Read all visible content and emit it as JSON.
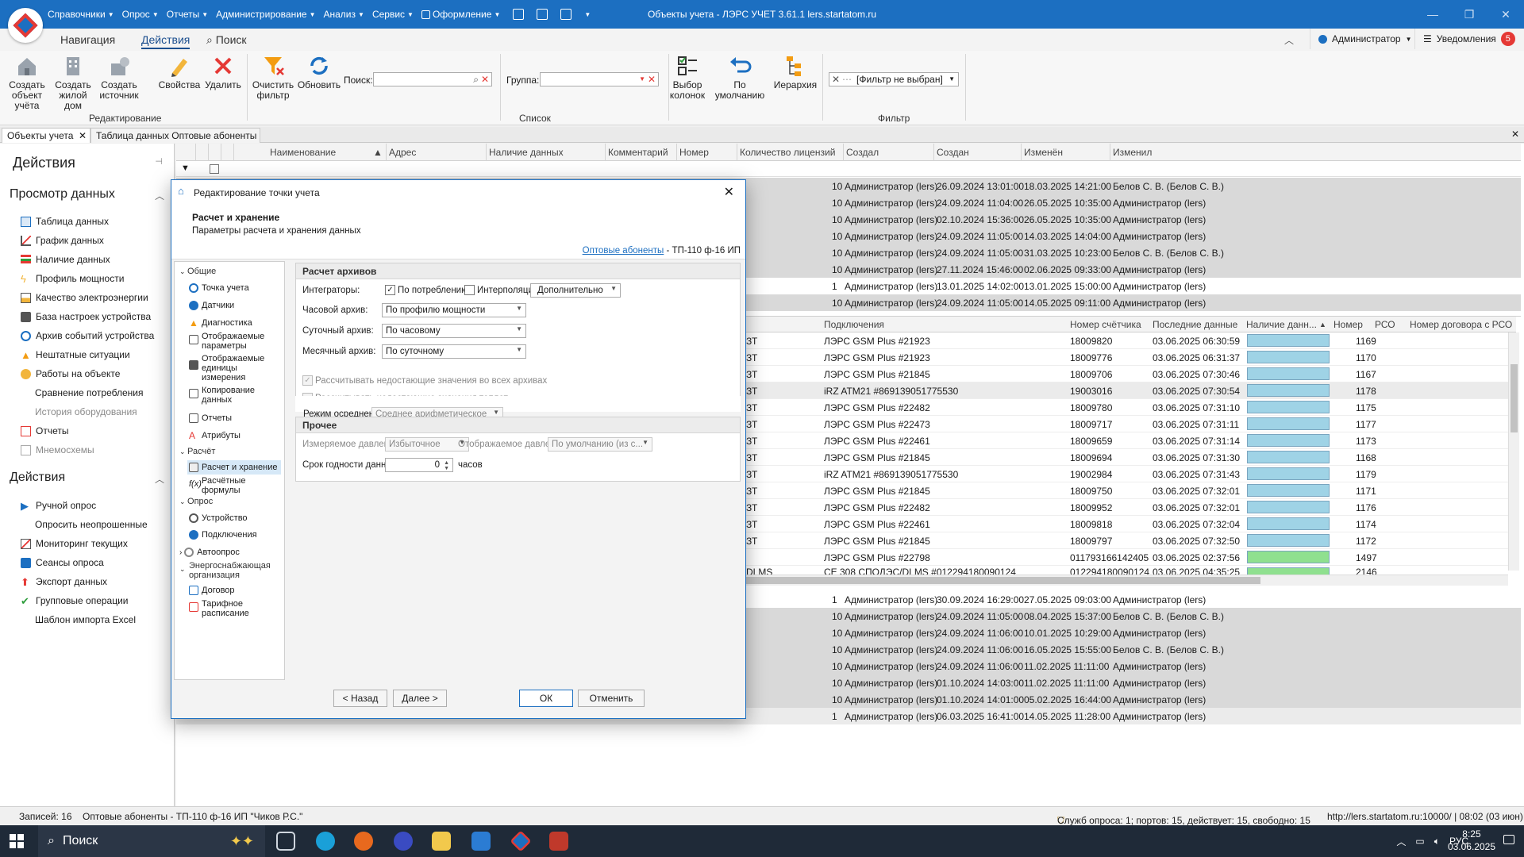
{
  "titlebar": {
    "menu": [
      "Справочники",
      "Опрос",
      "Отчеты",
      "Администрирование",
      "Анализ",
      "Сервис",
      "Оформление"
    ],
    "title": "Объекты учета - ЛЭРС УЧЕТ 3.61.1 lers.startatom.ru"
  },
  "ribbon_tabs": [
    "Навигация",
    "Действия",
    "Поиск"
  ],
  "user": {
    "name": "Администратор",
    "notifications_label": "Уведомления",
    "notifications_count": "5"
  },
  "ribbon": {
    "buttons": [
      "Создать объект учёта",
      "Создать жилой дом",
      "Создать источник",
      "Свойства",
      "Удалить",
      "Очистить фильтр",
      "Обновить",
      "Выбор колонок",
      "По умолчанию",
      "Иерархия"
    ],
    "search_label": "Поиск:",
    "group_label": "Группа:",
    "filter_value": "[Фильтр не выбран]",
    "groups": [
      "Редактирование",
      "Список",
      "Фильтр"
    ]
  },
  "doc_tabs": [
    "Объекты учета",
    "Таблица данных Оптовые абоненты - Т"
  ],
  "left_panel": {
    "title": "Действия",
    "view_section": "Просмотр данных",
    "view_items": [
      "Таблица данных",
      "График данных",
      "Наличие данных",
      "Профиль мощности",
      "Качество электроэнергии",
      "База настроек устройства",
      "Архив событий устройства",
      "Нештатные ситуации",
      "Работы на объекте",
      "Сравнение потребления",
      "История оборудования",
      "Отчеты",
      "Мнемосхемы"
    ],
    "actions_section": "Действия",
    "action_items": [
      "Ручной опрос",
      "Опросить неопрошенные",
      "Мониторинг текущих",
      "Сеансы опроса",
      "Экспорт данных",
      "Групповые операции",
      "Шаблон импорта Excel"
    ]
  },
  "grid": {
    "headers": [
      "Наименование",
      "Адрес",
      "Наличие данных",
      "Комментарий",
      "Номер",
      "Количество лицензий",
      "Создал",
      "Создан",
      "Изменён",
      "Изменил"
    ],
    "rows_top": [
      [
        "10",
        "Администратор (lers)",
        "26.09.2024 13:01:00",
        "18.03.2025 14:21:00",
        "Белов С. В. (Белов С. В.)"
      ],
      [
        "10",
        "Администратор (lers)",
        "24.09.2024 11:04:00",
        "26.05.2025 10:35:00",
        "Администратор (lers)"
      ],
      [
        "10",
        "Администратор (lers)",
        "02.10.2024 15:36:00",
        "26.05.2025 10:35:00",
        "Администратор (lers)"
      ],
      [
        "10",
        "Администратор (lers)",
        "24.09.2024 11:05:00",
        "14.03.2025 14:04:00",
        "Администратор (lers)"
      ],
      [
        "10",
        "Администратор (lers)",
        "24.09.2024 11:05:00",
        "31.03.2025 10:23:00",
        "Белов С. В. (Белов С. В.)"
      ],
      [
        "10",
        "Администратор (lers)",
        "27.11.2024 15:46:00",
        "02.06.2025 09:33:00",
        "Администратор (lers)"
      ],
      [
        "1",
        "Администратор (lers)",
        "13.01.2025 14:02:00",
        "13.01.2025 15:00:00",
        "Администратор (lers)"
      ],
      [
        "10",
        "Администратор (lers)",
        "24.09.2024 11:05:00",
        "14.05.2025 09:11:00",
        "Администратор (lers)"
      ]
    ],
    "rows_bottom": [
      [
        "1",
        "Администратор (lers)",
        "30.09.2024 16:29:00",
        "27.05.2025 09:03:00",
        "Администратор (lers)"
      ],
      [
        "10",
        "Администратор (lers)",
        "24.09.2024 11:05:00",
        "08.04.2025 15:37:00",
        "Белов С. В. (Белов С. В.)"
      ],
      [
        "10",
        "Администратор (lers)",
        "24.09.2024 11:06:00",
        "10.01.2025 10:29:00",
        "Администратор (lers)"
      ],
      [
        "10",
        "Администратор (lers)",
        "24.09.2024 11:06:00",
        "16.05.2025 15:55:00",
        "Белов С. В. (Белов С. В.)"
      ],
      [
        "10",
        "Администратор (lers)",
        "24.09.2024 11:06:00",
        "11.02.2025 11:11:00",
        "Администратор (lers)"
      ],
      [
        "10",
        "Администратор (lers)",
        "01.10.2024 14:03:00",
        "11.02.2025 11:11:00",
        "Администратор (lers)"
      ],
      [
        "10",
        "Администратор (lers)",
        "01.10.2024 14:01:00",
        "05.02.2025 16:44:00",
        "Администратор (lers)"
      ],
      [
        "1",
        "Администратор (lers)",
        "06.03.2025 16:41:00",
        "14.05.2025 11:28:00",
        "Администратор (lers)"
      ]
    ]
  },
  "inner_grid": {
    "headers": [
      "Подключения",
      "Номер счётчика",
      "Последние данные",
      "Наличие данн...",
      "Номер",
      "РСО",
      "Номер договора с РСО"
    ],
    "rows": [
      [
        "ЗТ",
        "ЛЭРС GSM Plus #21923",
        "18009820",
        "03.06.2025 06:30:59",
        "1169"
      ],
      [
        "ЗТ",
        "ЛЭРС GSM Plus #21923",
        "18009776",
        "03.06.2025 06:31:37",
        "1170"
      ],
      [
        "ЗТ",
        "ЛЭРС GSM Plus #21845",
        "18009706",
        "03.06.2025 07:30:46",
        "1167"
      ],
      [
        "ЗТ",
        "iRZ ATM21 #869139051775530",
        "19003016",
        "03.06.2025 07:30:54",
        "1178"
      ],
      [
        "ЗТ",
        "ЛЭРС GSM Plus #22482",
        "18009780",
        "03.06.2025 07:31:10",
        "1175"
      ],
      [
        "ЗТ",
        "ЛЭРС GSM Plus #22473",
        "18009717",
        "03.06.2025 07:31:11",
        "1177"
      ],
      [
        "ЗТ",
        "ЛЭРС GSM Plus #22461",
        "18009659",
        "03.06.2025 07:31:14",
        "1173"
      ],
      [
        "ЗТ",
        "ЛЭРС GSM Plus #21845",
        "18009694",
        "03.06.2025 07:31:30",
        "1168"
      ],
      [
        "ЗТ",
        "iRZ ATM21 #869139051775530",
        "19002984",
        "03.06.2025 07:31:43",
        "1179"
      ],
      [
        "ЗТ",
        "ЛЭРС GSM Plus #21845",
        "18009750",
        "03.06.2025 07:32:01",
        "1171"
      ],
      [
        "ЗТ",
        "ЛЭРС GSM Plus #22482",
        "18009952",
        "03.06.2025 07:32:01",
        "1176"
      ],
      [
        "ЗТ",
        "ЛЭРС GSM Plus #22461",
        "18009818",
        "03.06.2025 07:32:04",
        "1174"
      ],
      [
        "ЗТ",
        "ЛЭРС GSM Plus #21845",
        "18009797",
        "03.06.2025 07:32:50",
        "1172"
      ],
      [
        "",
        "ЛЭРС GSM Plus #22798",
        "011793166142405",
        "03.06.2025 02:37:56",
        "1497"
      ],
      [
        "DLMS",
        "CE 308 СПОДЭС/DLMS #012294180090124",
        "012294180090124",
        "03.06.2025 04:35:25",
        "2146"
      ]
    ]
  },
  "dialog": {
    "title": "Редактирование точки учета",
    "heading": "Расчет и хранение",
    "subheading": "Параметры расчета и хранения данных",
    "breadcrumb_link": "Оптовые абоненты",
    "breadcrumb_rest": "- ТП-110 ф-16  ИП",
    "tree": {
      "sec_general": "Общие",
      "general": [
        "Точка учета",
        "Датчики",
        "Диагностика",
        "Отображаемые параметры",
        "Отображаемые единицы измерения",
        "Копирование данных",
        "Отчеты",
        "Атрибуты"
      ],
      "sec_calc": "Расчёт",
      "calc": [
        "Расчет и хранение",
        "Расчётные формулы"
      ],
      "sec_poll": "Опрос",
      "poll": [
        "Устройство",
        "Подключения",
        "Автоопрос"
      ],
      "sec_supply": "Энергоснабжающая организация",
      "supply": [
        "Договор",
        "Тарифное расписание"
      ]
    },
    "archives": {
      "section": "Расчет архивов",
      "integrators_label": "Интеграторы:",
      "cb_consumption": "По потреблению",
      "cb_interp": "Интерполяция",
      "extra": "Дополнительно",
      "hourly_label": "Часовой архив:",
      "hourly": "По профилю мощности",
      "daily_label": "Суточный архив:",
      "daily": "По часовому",
      "monthly_label": "Месячный архив:",
      "monthly": "По суточному",
      "cb_missing_all": "Рассчитывать недостающие значения во всех архивах",
      "cb_missing_heat": "Рассчитывать недостающие значения теплот",
      "avg_label": "Режим осреднения:",
      "avg": "Среднее арифметическое"
    },
    "other": {
      "section": "Прочее",
      "pressure_label": "Измеряемое давление:",
      "pressure": "Избыточное",
      "disp_pressure_label": "Отображаемое давление:",
      "disp_pressure": "По умолчанию (из с...",
      "shelf_label": "Срок годности данных:",
      "shelf_value": "0",
      "shelf_unit": "часов"
    },
    "buttons": {
      "back": "< Назад",
      "next": "Далее >",
      "ok": "ОК",
      "cancel": "Отменить"
    }
  },
  "status": {
    "records": "Записей: 16",
    "object": "Оптовые абоненты - ТП-110 ф-16  ИП \"Чиков Р.С.\"",
    "services": "Служб опроса: 1; портов: 15, действует: 15, свободно: 15",
    "server": "http://lers.startatom.ru:10000/ | 08:02 (03 июн)"
  },
  "taskbar": {
    "search": "Поиск",
    "lang": "РУС",
    "time": "8:25",
    "date": "03.06.2025"
  }
}
